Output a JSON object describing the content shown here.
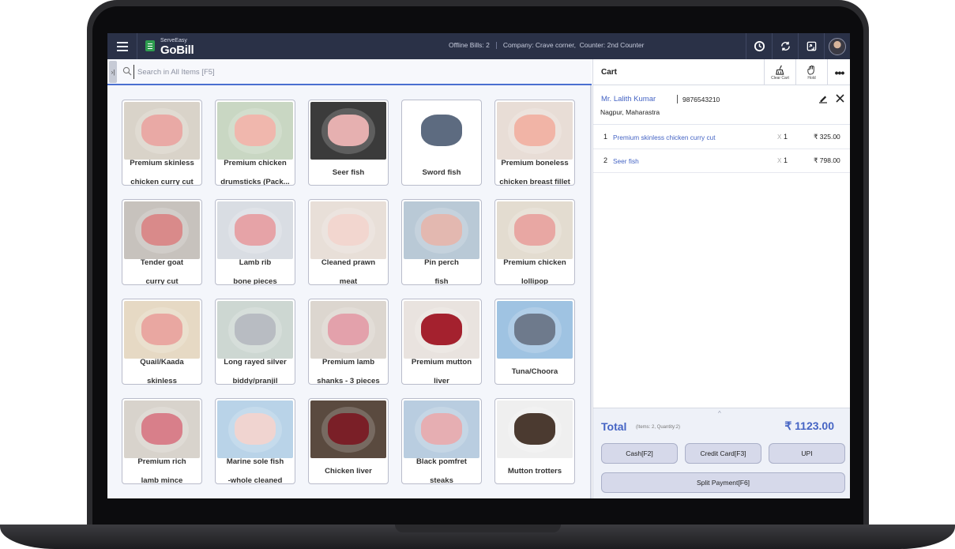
{
  "header": {
    "logo_small": "ServeEasy",
    "logo_big": "GoBill",
    "offline_bills": "Offline Bills: 2",
    "company": "Company: Crave corner,",
    "counter": "Counter: 2nd Counter",
    "icons": [
      "menu-icon",
      "history-icon",
      "sync-icon",
      "switch-icon",
      "avatar"
    ]
  },
  "search": {
    "placeholder": "Search in All Items [F5]",
    "collapse_glyph": "›|"
  },
  "items": [
    {
      "name": "Premium skinless chicken curry cut",
      "line1": "Premium skinless",
      "line2": "chicken curry cut",
      "bg": "#d9d3c9",
      "food": "#e9a9a5"
    },
    {
      "name": "Premium chicken drumsticks (Pack...",
      "line1": "Premium chicken",
      "line2": "drumsticks (Pack...",
      "bg": "#c9d7c3",
      "food": "#f0b7ad"
    },
    {
      "name": "Seer fish",
      "line1": "Seer fish",
      "line2": "",
      "bg": "#3b3b3b",
      "food": "#e6b0b0"
    },
    {
      "name": "Sword fish",
      "line1": "Sword fish",
      "line2": "",
      "bg": "#ffffff",
      "food": "#5d6b80"
    },
    {
      "name": "Premium boneless chicken breast fillet",
      "line1": "Premium boneless",
      "line2": "chicken breast fillet",
      "bg": "#e8ddd6",
      "food": "#f1b4a6"
    },
    {
      "name": "Tender goat curry cut",
      "line1": "Tender goat",
      "line2": "curry cut",
      "bg": "#c7c2bd",
      "food": "#d98a8a"
    },
    {
      "name": "Lamb rib bone pieces",
      "line1": "Lamb rib",
      "line2": "bone pieces",
      "bg": "#d9dde3",
      "food": "#e6a3a7"
    },
    {
      "name": "Cleaned prawn meat",
      "line1": "Cleaned prawn",
      "line2": "meat",
      "bg": "#e8dfd8",
      "food": "#f2d6cf"
    },
    {
      "name": "Pin perch fish",
      "line1": "Pin perch",
      "line2": "fish",
      "bg": "#b9c9d6",
      "food": "#e3b8b0"
    },
    {
      "name": "Premium chicken lollipop",
      "line1": "Premium chicken",
      "line2": "lollipop",
      "bg": "#e3dcd0",
      "food": "#e8a7a3"
    },
    {
      "name": "Quail/Kaada skinless",
      "line1": "Quail/Kaada",
      "line2": "skinless",
      "bg": "#e6d9c4",
      "food": "#e9a7a1"
    },
    {
      "name": "Long rayed silver biddy/pranjil",
      "line1": "Long rayed silver",
      "line2": "biddy/pranjil",
      "bg": "#cdd7d2",
      "food": "#b8bcc2"
    },
    {
      "name": "Premium lamb shanks - 3 pieces",
      "line1": "Premium lamb",
      "line2": "shanks - 3 pieces",
      "bg": "#dcd6cf",
      "food": "#e3a1ab"
    },
    {
      "name": "Premium mutton liver",
      "line1": "Premium mutton",
      "line2": "liver",
      "bg": "#e9e3df",
      "food": "#a4212e"
    },
    {
      "name": "Tuna/Choora",
      "line1": "Tuna/Choora",
      "line2": "",
      "bg": "#9fc3e2",
      "food": "#6e7a8c"
    },
    {
      "name": "Premium rich lamb mince",
      "line1": "Premium rich",
      "line2": "lamb mince",
      "bg": "#d8d3cc",
      "food": "#d87f8a"
    },
    {
      "name": "Marine sole fish -whole cleaned",
      "line1": "Marine sole fish",
      "line2": "-whole cleaned",
      "bg": "#b9d3e8",
      "food": "#f0d4d0"
    },
    {
      "name": "Chicken liver",
      "line1": "Chicken liver",
      "line2": "",
      "bg": "#5a4a3f",
      "food": "#7a1f27"
    },
    {
      "name": "Black pomfret steaks",
      "line1": "Black pomfret",
      "line2": "steaks",
      "bg": "#b9cde0",
      "food": "#e6aeb2"
    },
    {
      "name": "Mutton trotters",
      "line1": "Mutton trotters",
      "line2": "",
      "bg": "#efefef",
      "food": "#4b3a30"
    }
  ],
  "cart": {
    "title": "Cart",
    "clear_label": "Clear Cart",
    "hold_label": "Hold",
    "more_glyph": "•••",
    "customer_name": "Mr. Lalith Kumar",
    "customer_phone": "9876543210",
    "customer_city": "Nagpur, Maharastra",
    "lines": [
      {
        "no": "1",
        "name": "Premium skinless chicken curry cut",
        "x": "X",
        "qty": "1",
        "price": "₹ 325.00"
      },
      {
        "no": "2",
        "name": "Seer fish",
        "x": "X",
        "qty": "1",
        "price": "₹ 798.00"
      }
    ],
    "caret": "^",
    "total_label": "Total",
    "total_meta": "(Items: 2, Quantity:2)",
    "total_value": "₹ 1123.00",
    "cash_label": "Cash[F2]",
    "card_label": "Credit Card[F3]",
    "upi_label": "UPI",
    "split_label": "Split Payment[F6]"
  },
  "colors": {
    "header_bg": "#2a3147",
    "accent": "#4564c4",
    "logo_green": "#2e9d4f",
    "button_bg": "#d6d9ea"
  }
}
